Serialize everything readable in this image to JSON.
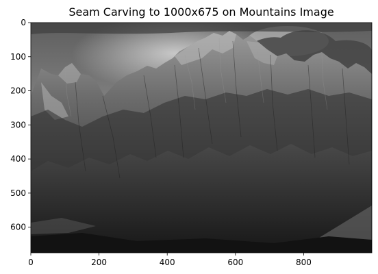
{
  "chart_data": {
    "type": "image",
    "title": "Seam Carving to 1000x675 on Mountains Image",
    "xlabel": "",
    "ylabel": "",
    "image_width": 1000,
    "image_height": 675,
    "xlim": [
      0,
      1000
    ],
    "ylim": [
      675,
      0
    ],
    "x_ticks": [
      0,
      200,
      400,
      600,
      800
    ],
    "y_ticks": [
      0,
      100,
      200,
      300,
      400,
      500,
      600
    ],
    "x_tick_labels": [
      "0",
      "200",
      "400",
      "600",
      "800"
    ],
    "y_tick_labels": [
      "0",
      "100",
      "200",
      "300",
      "400",
      "500",
      "600"
    ],
    "colormap": "grayscale",
    "content": "black and white photograph of jagged mountain peaks under a cloudy sky"
  }
}
